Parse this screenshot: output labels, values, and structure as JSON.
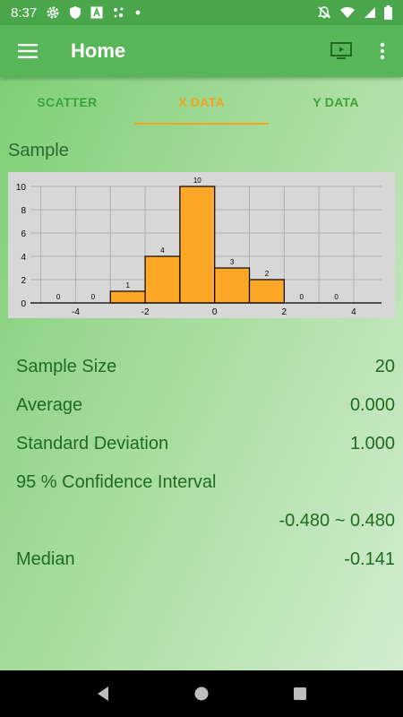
{
  "status_bar": {
    "time": "8:37",
    "left_icons": [
      "gear-icon",
      "shield-icon",
      "font-app-icon",
      "assistant-dots-icon",
      "dot-icon"
    ],
    "right_icons": [
      "notifications-off-icon",
      "wifi-icon",
      "signal-icon",
      "battery-icon"
    ]
  },
  "app_bar": {
    "title": "Home",
    "menu_icon": "hamburger-menu-icon",
    "actions": [
      "cast-screen-icon",
      "more-vert-icon"
    ]
  },
  "tabs": [
    {
      "label": "SCATTER",
      "active": false
    },
    {
      "label": "X DATA",
      "active": true
    },
    {
      "label": "Y DATA",
      "active": false
    }
  ],
  "section": {
    "title": "Sample"
  },
  "chart_data": {
    "type": "bar",
    "bins": [
      {
        "x0": -5,
        "x1": -4,
        "value": 0
      },
      {
        "x0": -4,
        "x1": -3,
        "value": 0
      },
      {
        "x0": -3,
        "x1": -2,
        "value": 1
      },
      {
        "x0": -2,
        "x1": -1,
        "value": 4
      },
      {
        "x0": -1,
        "x1": 0,
        "value": 10
      },
      {
        "x0": 0,
        "x1": 1,
        "value": 3
      },
      {
        "x0": 1,
        "x1": 2,
        "value": 2
      },
      {
        "x0": 2,
        "x1": 3,
        "value": 0
      },
      {
        "x0": 3,
        "x1": 4,
        "value": 0
      }
    ],
    "xlim": [
      -5.3,
      4.8
    ],
    "ylim": [
      0,
      10
    ],
    "x_ticks": [
      -4,
      -2,
      0,
      2,
      4
    ],
    "y_ticks": [
      0,
      2,
      4,
      6,
      8,
      10
    ],
    "grid": true,
    "bar_color": "#ffa726",
    "bar_edge_color": "#000000",
    "background": "#d7d7d7"
  },
  "stats": {
    "sample_size_label": "Sample Size",
    "sample_size_value": "20",
    "average_label": "Average",
    "average_value": "0.000",
    "std_label": "Standard Deviation",
    "std_value": "1.000",
    "ci_label": "95 % Confidence Interval",
    "ci_value": "-0.480 ~ 0.480",
    "median_label": "Median",
    "median_value": "-0.141"
  },
  "nav_bar": {
    "buttons": [
      "back-icon",
      "home-icon",
      "recents-icon"
    ]
  },
  "colors": {
    "status_bar": "#49a64b",
    "app_bar": "#58b65a",
    "tab_text": "#3ba33d",
    "tab_active": "#f6a21a",
    "stat_text": "#1f6b22"
  }
}
